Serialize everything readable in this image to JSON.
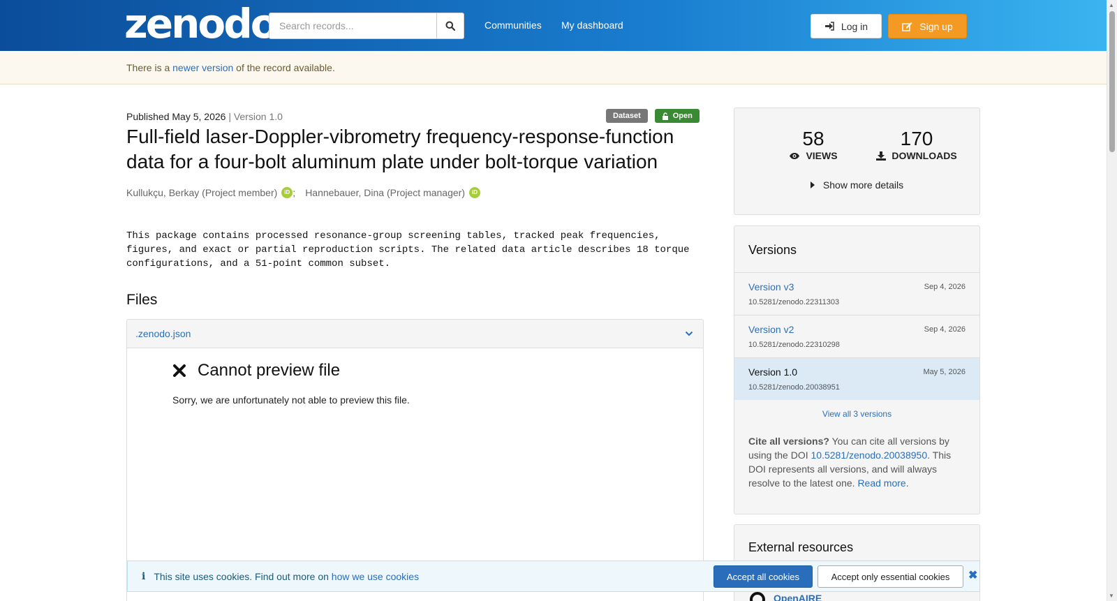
{
  "header": {
    "logo": "zenodo",
    "search_placeholder": "Search records...",
    "nav": [
      "Communities",
      "My dashboard"
    ],
    "login_label": "Log in",
    "signup_label": "Sign up"
  },
  "notice": {
    "before": "There is a ",
    "link": "newer version",
    "after": " of the record available."
  },
  "record": {
    "published": "Published May 5, 2026",
    "separator": " | ",
    "version": "Version 1.0",
    "badge_type": "Dataset",
    "badge_access": "Open",
    "title": "Full-field laser-Doppler-vibrometry frequency-response-function data for a four-bolt aluminum plate under bolt-torque variation",
    "creators": [
      {
        "name": "Kullukçu, Berkay (Project member)"
      },
      {
        "name": "Hannebauer, Dina (Project manager)"
      }
    ],
    "creator_sep": ";",
    "description": "This package contains processed resonance-group screening tables, tracked peak frequencies, figures, and exact or partial reproduction scripts. The related data article describes 18 torque configurations, and a 51-point common subset."
  },
  "files": {
    "heading": "Files",
    "file_name": ".zenodo.json",
    "preview_title": "Cannot preview file",
    "preview_msg": "Sorry, we are unfortunately not able to preview this file."
  },
  "stats": {
    "views": "58",
    "views_label": "VIEWS",
    "downloads": "170",
    "downloads_label": "DOWNLOADS",
    "more_details": "Show more details"
  },
  "versions": {
    "heading": "Versions",
    "items": [
      {
        "name": "Version v3",
        "date": "Sep 4, 2026",
        "doi": "10.5281/zenodo.22311303"
      },
      {
        "name": "Version v2",
        "date": "Sep 4, 2026",
        "doi": "10.5281/zenodo.22310298"
      },
      {
        "name": "Version 1.0",
        "date": "May 5, 2026",
        "doi": "10.5281/zenodo.20038951"
      }
    ],
    "view_all": "View all 3 versions",
    "cite_bold": "Cite all versions?",
    "cite_text1": " You can cite all versions by using the DOI ",
    "cite_doi": "10.5281/zenodo.20038950",
    "cite_text2": ". This DOI represents all versions, and will always resolve to the latest one. ",
    "read_more": "Read more",
    "cite_end": "."
  },
  "external": {
    "heading": "External resources",
    "openaire": "OpenAIRE"
  },
  "cookie": {
    "text": "This site uses cookies. Find out more on ",
    "link": "how we use cookies",
    "accept_all": "Accept all cookies",
    "accept_essential": "Accept only essential cookies"
  },
  "colors": {
    "brand_blue": "#0b4d9a",
    "signup_orange": "#f39a24",
    "link_blue": "#2a6ebb",
    "open_green": "#3a8a33"
  }
}
